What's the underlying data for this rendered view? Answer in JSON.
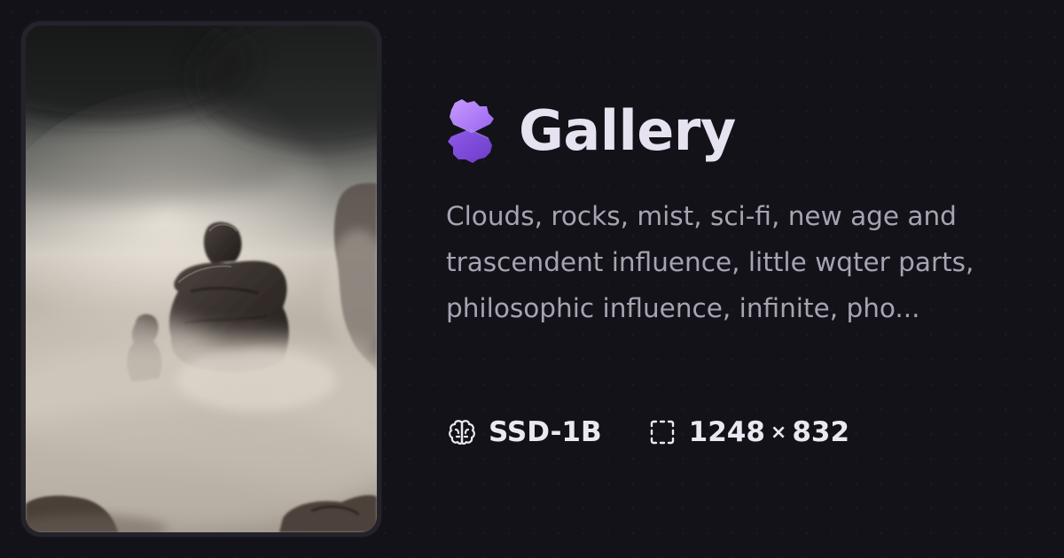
{
  "title": "Gallery",
  "logo": {
    "icon": "gallery-logo-icon",
    "color_top": "#b889ff",
    "color_bottom": "#7a4ad6"
  },
  "description": "Clouds, rocks, mist, sci-fi, new age and trascendent influence, little wqter parts, philosophic influence, infinite, pho...",
  "model": {
    "icon": "brain-icon",
    "label": "SSD-1B"
  },
  "dimensions": {
    "icon": "dimensions-frame-icon",
    "width": "1248",
    "separator": "×",
    "height": "832"
  },
  "image": {
    "subject": "rock formations rising above clouds and mist"
  }
}
